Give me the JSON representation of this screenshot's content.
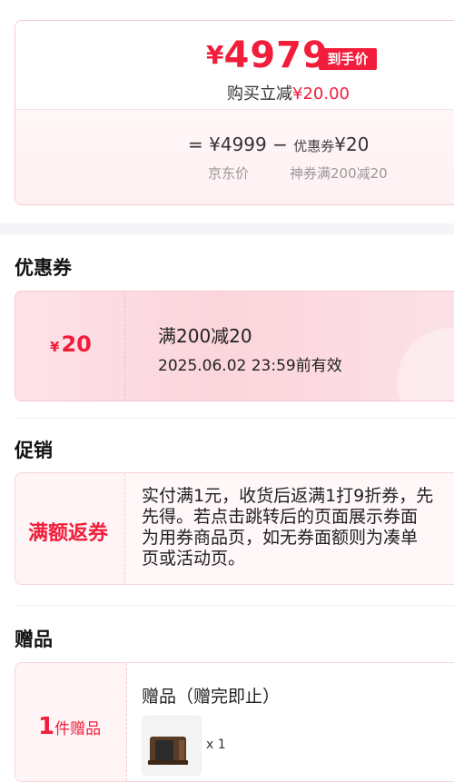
{
  "price": {
    "final_symbol": "¥",
    "final_amount": "4979",
    "tag": "到手价",
    "discount_label": "购买立减",
    "discount_value": "¥20.00",
    "formula": {
      "eq": "=",
      "base": "¥4999",
      "minus": "−",
      "coupon_small": "优惠券",
      "coupon_amount": "¥20",
      "base_sub": "京东价",
      "coupon_sub": "神券满200减20"
    }
  },
  "coupons": {
    "section_title": "优惠券",
    "item": {
      "symbol": "¥",
      "amount": "20",
      "title": "满200减20",
      "validity": "2025.06.02 23:59前有效"
    }
  },
  "promotion": {
    "section_title": "促销",
    "label": "满额返券",
    "lines": [
      "实付满1元，收货后返满1打9折券，先",
      "先得。若点击跳转后的页面展示券面",
      "为用券商品页，如无券面额则为凑单",
      "页或活动页。"
    ]
  },
  "gifts": {
    "section_title": "赠品",
    "count": "1",
    "count_unit": "件赠品",
    "title": "赠品（赠完即止）",
    "qty": "x 1"
  },
  "colors": {
    "accent": "#f21d3b",
    "coupon_bg": "#fcd5dc"
  }
}
